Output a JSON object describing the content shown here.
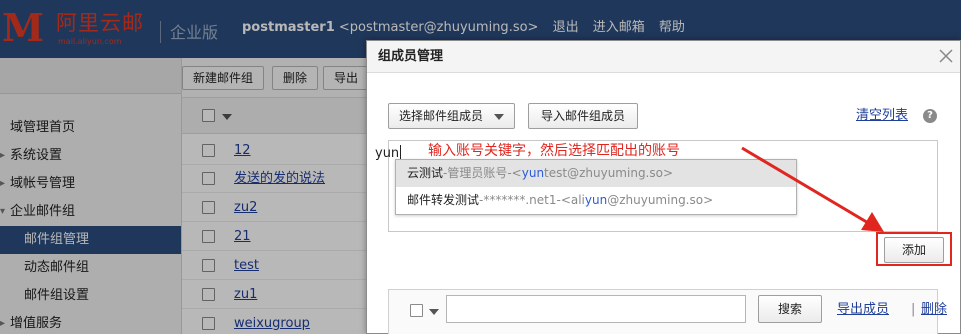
{
  "header": {
    "logo_mark": "M",
    "logo_cn": "阿里云邮",
    "logo_en": "mail.aliyun.com",
    "edition": "企业版",
    "username": "postmaster1",
    "email": "<postmaster@zhuyuming.so>",
    "links": [
      "退出",
      "进入邮箱",
      "帮助"
    ]
  },
  "toolbar": {
    "buttons": [
      "新建邮件组",
      "删除",
      "导出"
    ]
  },
  "sidebar": {
    "items": [
      {
        "label": "域管理首页"
      },
      {
        "label": "系统设置"
      },
      {
        "label": "域帐号管理"
      },
      {
        "label": "企业邮件组"
      },
      {
        "label": "邮件组管理",
        "active": true
      },
      {
        "label": "动态邮件组"
      },
      {
        "label": "邮件组设置"
      },
      {
        "label": "增值服务"
      }
    ]
  },
  "group_list": [
    "12",
    "发送的发的说法",
    "zu2",
    "21",
    "test",
    "zu1",
    "weixugroup"
  ],
  "modal": {
    "title": "组成员管理",
    "select_members_label": "选择邮件组成员",
    "import_members_label": "导入邮件组成员",
    "clear_list_label": "清空列表",
    "help_glyph": "?",
    "typed_text": "yun",
    "hint_text": "输入账号关键字，然后选择匹配出的账号",
    "suggestions": [
      {
        "name": "云测试",
        "meta": "-管理员账号-<",
        "hit": "yun",
        "rest": "test@zhuyuming.so>"
      },
      {
        "name": "邮件转发测试",
        "meta": "-*******.net1-<ali",
        "hit": "yun",
        "rest": "@zhuyuming.so>"
      }
    ],
    "add_label": "添加",
    "search_label": "搜索",
    "export_members_label": "导出成员",
    "separator": "|",
    "delete_label": "删除"
  },
  "colors": {
    "header_bg": "#2c4d7d",
    "logo_red": "#e23b26",
    "annotation_red": "#e0261f",
    "link_blue": "#1f3f9a",
    "keyword_blue": "#2d5bd6"
  }
}
